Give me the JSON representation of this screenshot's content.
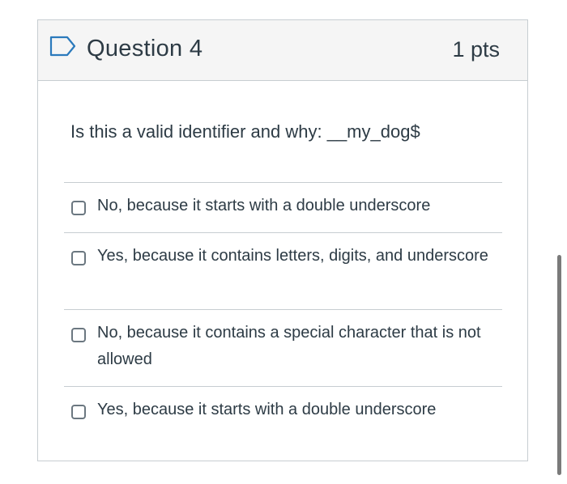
{
  "question": {
    "title": "Question 4",
    "points": "1 pts",
    "text": "Is this a valid identifier and why: __my_dog$",
    "flag_icon": "flag-outline-icon"
  },
  "answers": [
    {
      "label": "No, because it starts with a double underscore",
      "checked": false
    },
    {
      "label": "Yes, because it contains letters, digits, and underscore",
      "checked": false
    },
    {
      "label": "No, because it contains a special character that is not allowed",
      "checked": false
    },
    {
      "label": "Yes, because it starts with a double underscore",
      "checked": false
    }
  ],
  "colors": {
    "text": "#2d3b45",
    "border": "#c7cdd1",
    "header_bg": "#f5f5f5",
    "flag": "#2b7abc"
  }
}
